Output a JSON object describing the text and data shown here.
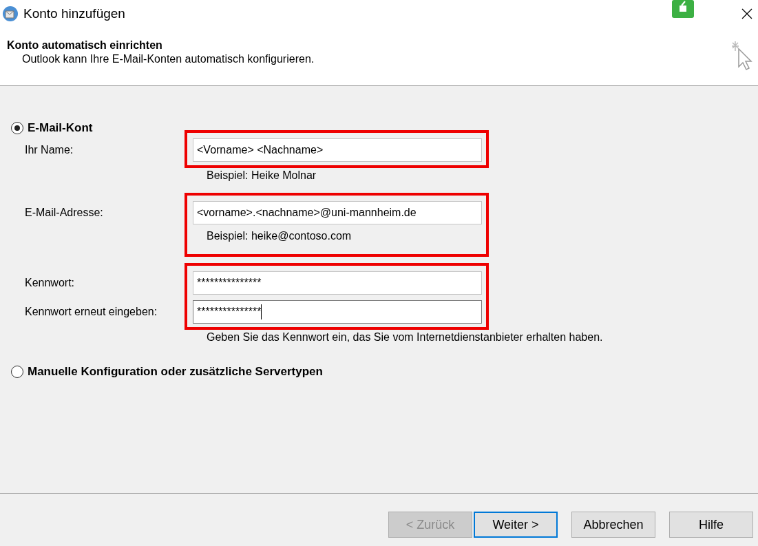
{
  "window": {
    "title": "Konto hinzufügen"
  },
  "header": {
    "title": "Konto automatisch einrichten",
    "subtitle": "Outlook kann Ihre E-Mail-Konten automatisch konfigurieren."
  },
  "options": [
    {
      "label": "E-Mail-Kont",
      "selected": true
    },
    {
      "label": "Manuelle Konfiguration oder zusätzliche Servertypen",
      "selected": false
    }
  ],
  "groups": [
    {
      "fields": [
        {
          "label": "Ihr Name:",
          "value": "<Vorname> <Nachname>",
          "focused": false
        }
      ],
      "caption": "Beispiel: Heike Molnar"
    },
    {
      "fields": [
        {
          "label": "E-Mail-Adresse:",
          "value": "<vorname>.<nachname>@uni-mannheim.de",
          "focused": false
        }
      ],
      "hint": "Beispiel: heike@contoso.com"
    },
    {
      "fields": [
        {
          "label": "Kennwort:",
          "value": "***************",
          "focused": false
        },
        {
          "label": "Kennwort erneut eingeben:",
          "value": "***************",
          "focused": true
        }
      ],
      "caption": "Geben Sie das Kennwort ein, das Sie vom Internetdienstanbieter erhalten haben."
    }
  ],
  "buttons": [
    {
      "label": "< Zurück",
      "disabled": true,
      "default": false
    },
    {
      "label": "Weiter >",
      "disabled": false,
      "default": true
    },
    {
      "label": "Abbrechen",
      "disabled": false,
      "default": false
    },
    {
      "label": "Hilfe",
      "disabled": false,
      "default": false
    }
  ]
}
